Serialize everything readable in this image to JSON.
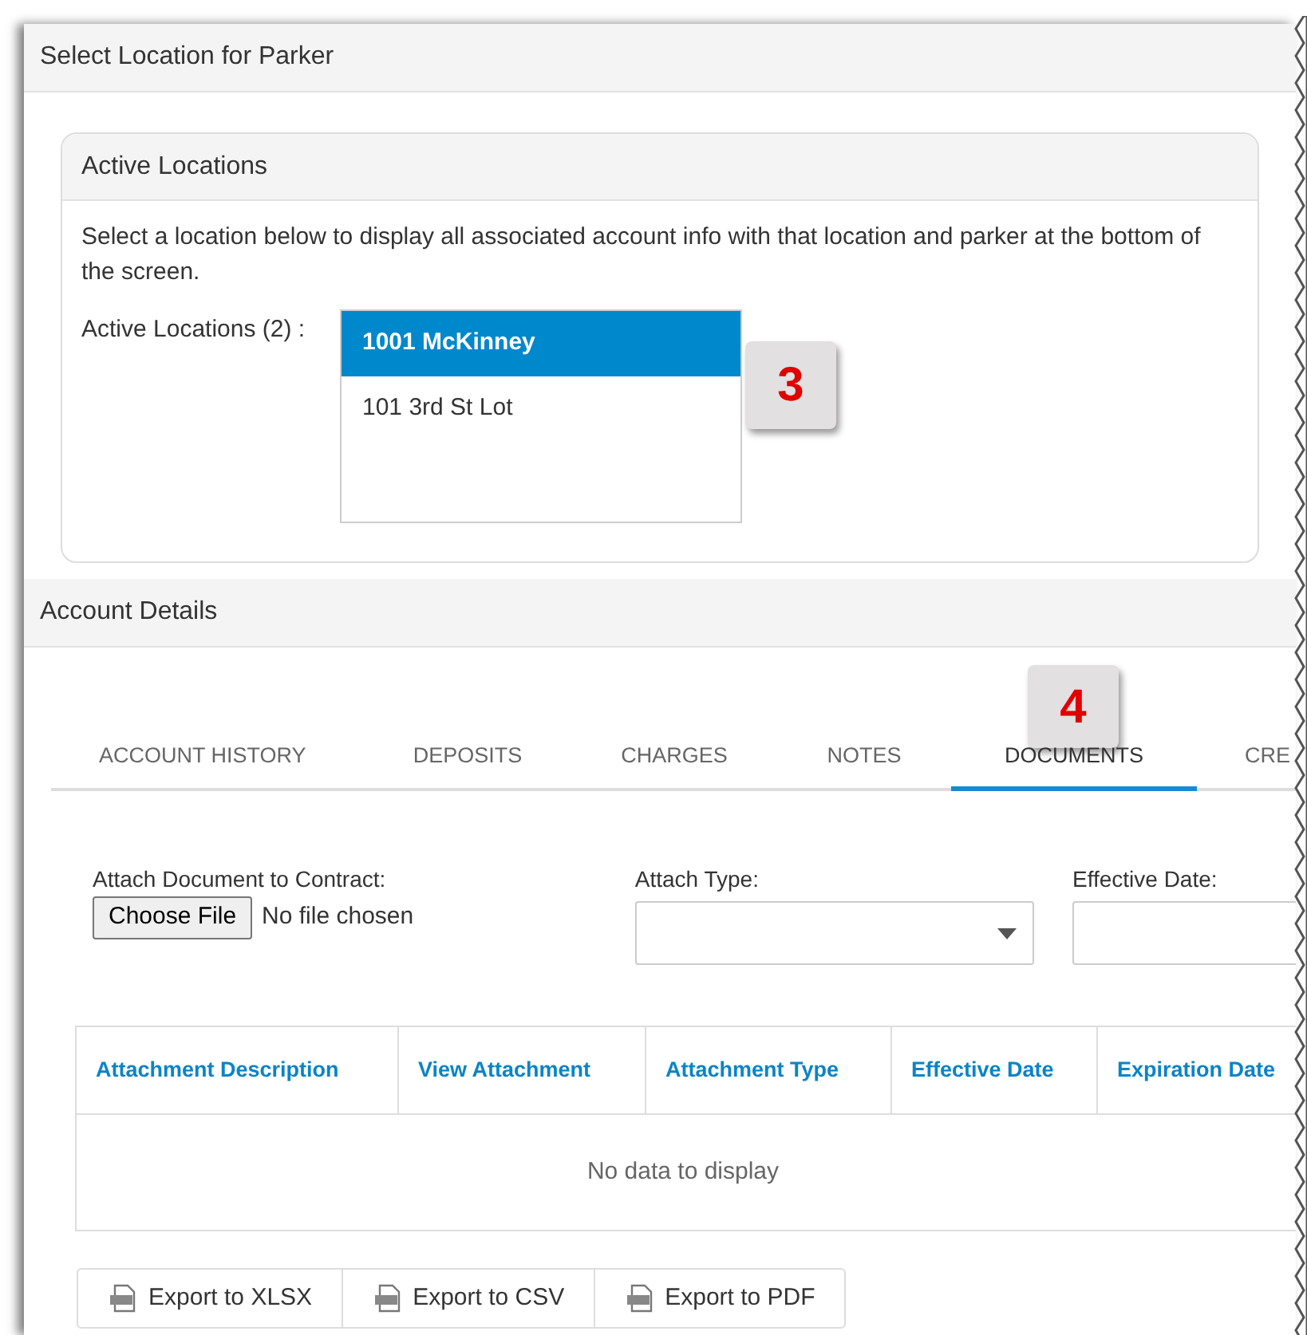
{
  "panel_title": "Select Location for Parker",
  "active_locations": {
    "title": "Active Locations",
    "description": "Select a location below to display all associated account info with that location and parker at the bottom of the screen.",
    "label": "Active Locations (2) :",
    "items": [
      {
        "label": "1001 McKinney",
        "selected": true
      },
      {
        "label": "101 3rd St Lot",
        "selected": false
      }
    ],
    "callout": "3"
  },
  "account_details": {
    "title": "Account Details",
    "callout": "4",
    "tabs": [
      {
        "label": "ACCOUNT HISTORY",
        "selected": false
      },
      {
        "label": "DEPOSITS",
        "selected": false
      },
      {
        "label": "CHARGES",
        "selected": false
      },
      {
        "label": "NOTES",
        "selected": false
      },
      {
        "label": "DOCUMENTS",
        "selected": true
      },
      {
        "label": "CRE",
        "selected": false
      }
    ],
    "attach_label": "Attach Document to Contract:",
    "choose_file": "Choose File",
    "no_file": "No file chosen",
    "attach_type_label": "Attach Type:",
    "effective_date_label": "Effective Date:",
    "table": {
      "columns": [
        "Attachment Description",
        "View Attachment",
        "Attachment Type",
        "Effective Date",
        "Expiration Date"
      ],
      "empty": "No data to display"
    },
    "exports": [
      "Export to XLSX",
      "Export to CSV",
      "Export to PDF"
    ]
  }
}
